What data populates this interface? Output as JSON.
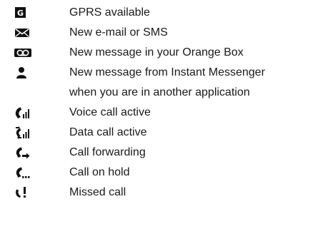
{
  "icon_color": "#111111",
  "items": [
    {
      "icon": "gprs-icon",
      "glyph": "G",
      "label": "GPRS available"
    },
    {
      "icon": "envelope-icon",
      "label": "New e-mail or SMS"
    },
    {
      "icon": "voicemail-icon",
      "label": "New message in your Orange Box"
    },
    {
      "icon": "person-icon",
      "label": "New message from Instant Messenger"
    },
    {
      "icon": null,
      "label": "when you are in another application"
    },
    {
      "icon": "voice-call-icon",
      "label": "Voice call active"
    },
    {
      "icon": "data-call-icon",
      "label": "Data call active"
    },
    {
      "icon": "call-forward-icon",
      "label": "Call forwarding"
    },
    {
      "icon": "call-hold-icon",
      "label": "Call on hold"
    },
    {
      "icon": "missed-call-icon",
      "label": "Missed call"
    }
  ]
}
